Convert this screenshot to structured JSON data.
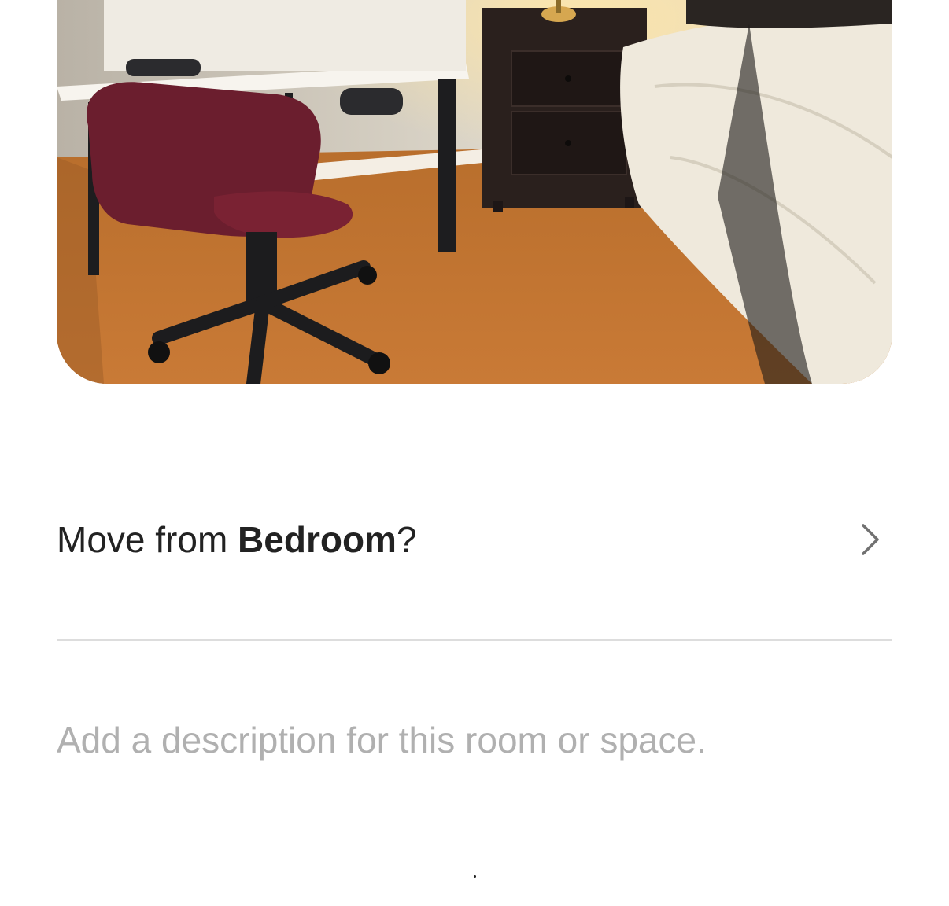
{
  "photo": {
    "subject": "bedroom-photo"
  },
  "move_row": {
    "prefix": "Move from ",
    "room": "Bedroom",
    "suffix": "?"
  },
  "description": {
    "placeholder": "Add a description for this room or space.",
    "value": ""
  },
  "icons": {
    "chevron": "chevron-right-icon"
  },
  "colors": {
    "text": "#222222",
    "placeholder": "#b0b0b0",
    "divider": "#dddddd"
  }
}
